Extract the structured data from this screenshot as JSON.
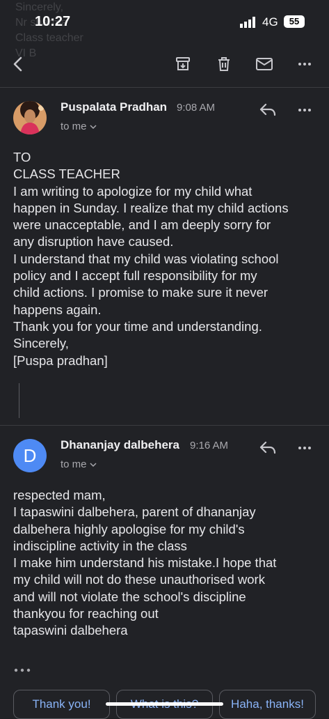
{
  "status_bar": {
    "time": "10:27",
    "network": "4G",
    "battery": "55"
  },
  "toolbar": {
    "icons": [
      "back-icon",
      "archive-icon",
      "trash-icon",
      "mail-icon",
      "more-icon"
    ]
  },
  "messages": [
    {
      "sender": "Puspalata Pradhan",
      "time": "9:08 AM",
      "to_line": "to me",
      "body": "TO\nCLASS TEACHER\nI am writing to apologize for my child what\nhappen in Sunday. I realize that my child actions\nwere unacceptable, and I am deeply sorry for\nany disruption  have caused.\nI understand that my child was violating school\npolicy and I accept full responsibility for my\nchild actions. I promise to make sure it never\nhappens again.\nThank you for your time and understanding.\nSincerely,\n[Puspa pradhan]"
    },
    {
      "sender": "Dhananjay dalbehera",
      "avatar_letter": "D",
      "time": "9:16 AM",
      "to_line": "to me",
      "body": "respected mam,\nI tapaswini dalbehera, parent of dhananjay\ndalbehera highly apologise for my child's\nindiscipline activity in the class\nI make him understand his mistake.I  hope that\nmy child will not do these unauthorised work\nand will not violate the school's  discipline\nthankyou for reaching out\ntapaswini dalbehera"
    }
  ],
  "ghost_text": [
    "Sincerely,",
    "Nr          sharma",
    "Class teacher",
    "VI B"
  ],
  "smart_replies": [
    "Thank you!",
    "What is this?",
    "Haha, thanks!"
  ],
  "colors": {
    "background": "#212226",
    "accent": "#8ab4f8",
    "avatar_d": "#4e8af4"
  }
}
